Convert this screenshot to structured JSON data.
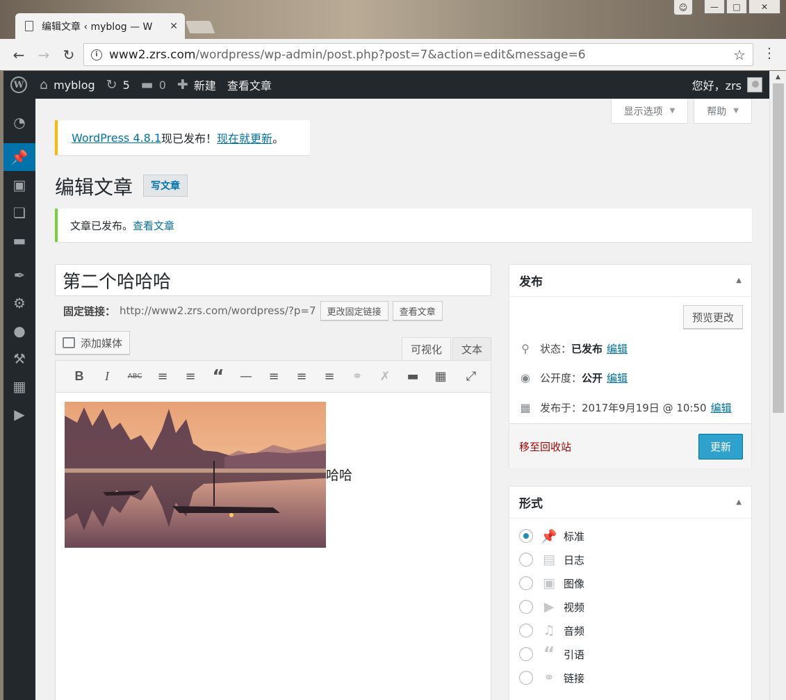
{
  "browser": {
    "tab_title": "编辑文章 ‹ myblog — W",
    "tab_close": "✕",
    "url_host": "www2.zrs.com",
    "url_path": "/wordpress/wp-admin/post.php?post=7&action=edit&message=6"
  },
  "adminbar": {
    "site_name": "myblog",
    "updates_count": "5",
    "comments_count": "0",
    "new_label": "新建",
    "view_post": "查看文章",
    "greeting": "您好，zrs"
  },
  "screen_tabs": {
    "options": "显示选项",
    "help": "帮助"
  },
  "update_nag": {
    "version_link": "WordPress 4.8.1",
    "text": "现已发布！",
    "update_link": "现在就更新",
    "end": "。"
  },
  "page": {
    "title": "编辑文章",
    "add_new": "写文章"
  },
  "notice": {
    "text": "文章已发布。",
    "link": "查看文章"
  },
  "post": {
    "title": "第二个哈哈哈",
    "permalink_label": "固定链接：",
    "permalink_url": "http://www2.zrs.com/wordpress/?p=7",
    "edit_permalink_button": "更改固定链接",
    "view_post_button": "查看文章",
    "body_text": "哈哈"
  },
  "editor": {
    "add_media": "添加媒体",
    "tab_visual": "可视化",
    "tab_text": "文本"
  },
  "publish_box": {
    "title": "发布",
    "preview_button": "预览更改",
    "status_label": "状态：",
    "status_value": "已发布",
    "visibility_label": "公开度：",
    "visibility_value": "公开",
    "published_on": "发布于：2017年9月19日 @ 10:50",
    "edit_link": "编辑",
    "trash_link": "移至回收站",
    "update_button": "更新"
  },
  "format_box": {
    "title": "形式",
    "options": [
      {
        "label": "标准",
        "checked": true,
        "icon": "pushpin-icon"
      },
      {
        "label": "日志",
        "checked": false,
        "icon": "aside-icon"
      },
      {
        "label": "图像",
        "checked": false,
        "icon": "image-icon"
      },
      {
        "label": "视频",
        "checked": false,
        "icon": "video-icon"
      },
      {
        "label": "音频",
        "checked": false,
        "icon": "audio-icon"
      },
      {
        "label": "引语",
        "checked": false,
        "icon": "quote-icon"
      },
      {
        "label": "链接",
        "checked": false,
        "icon": "link-icon"
      }
    ]
  },
  "colors": {
    "admin_bar": "#23282d",
    "accent": "#0073aa",
    "nag_border": "#ffba00",
    "success_border": "#7ad03a",
    "primary_button": "#2ea2cc",
    "trash": "#aa0000"
  }
}
